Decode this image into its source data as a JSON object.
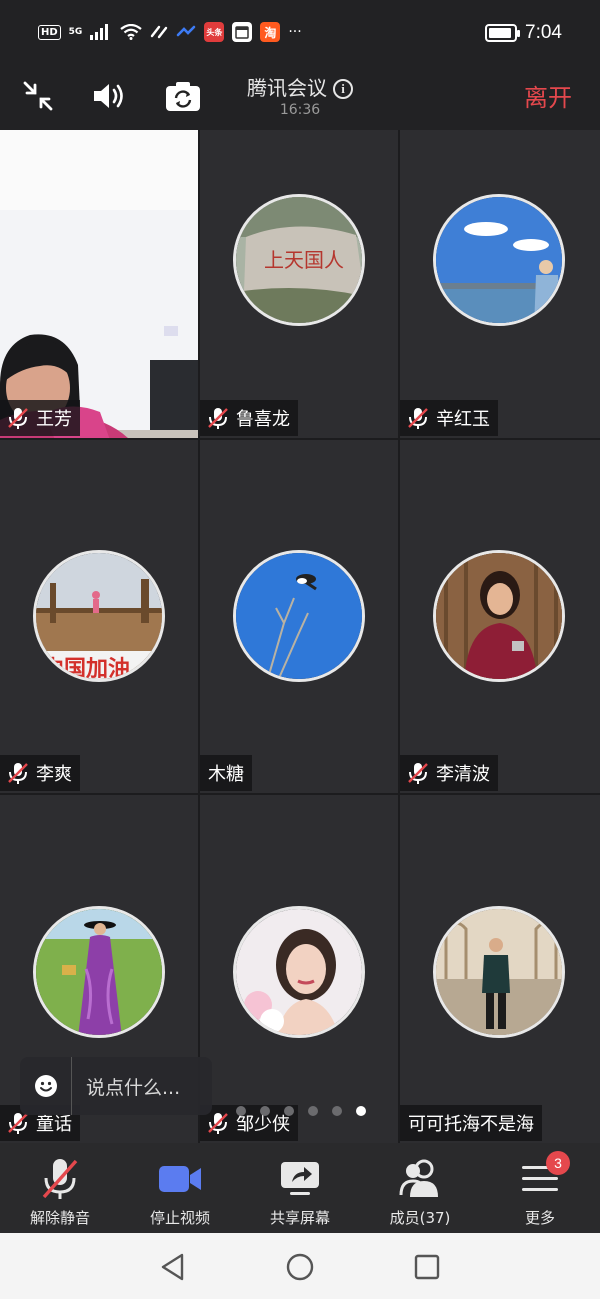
{
  "status_bar": {
    "hd": "HD",
    "network": "5G",
    "apps": [
      {
        "icon": "toutiao-app-icon",
        "label": "头条",
        "color": "#e03c3c"
      },
      {
        "icon": "calendar-app-icon",
        "label": "",
        "color": "#ffffff"
      },
      {
        "icon": "taobao-app-icon",
        "label": "淘",
        "color": "#ff5a1f"
      }
    ],
    "more": "···",
    "battery_level": 0.9,
    "time": "7:04"
  },
  "meeting": {
    "title": "腾讯会议",
    "timer": "16:36",
    "leave_label": "离开"
  },
  "participants": [
    {
      "name": "王芳",
      "muted": true,
      "type": "video"
    },
    {
      "name": "鲁喜龙",
      "muted": true,
      "type": "avatar",
      "avatar": "rock-avatar"
    },
    {
      "name": "辛红玉",
      "muted": true,
      "type": "avatar",
      "avatar": "lake-avatar"
    },
    {
      "name": "李爽",
      "muted": true,
      "type": "avatar",
      "avatar": "boardwalk-avatar",
      "avatar_text": "中国加油"
    },
    {
      "name": "木糖",
      "muted": false,
      "type": "avatar",
      "avatar": "bird-avatar"
    },
    {
      "name": "李清波",
      "muted": true,
      "type": "avatar",
      "avatar": "woman-red-avatar"
    },
    {
      "name": "童话",
      "muted": true,
      "type": "avatar",
      "avatar": "purple-dress-avatar"
    },
    {
      "name": "邹少侠",
      "muted": true,
      "type": "avatar",
      "avatar": "portrait-avatar"
    },
    {
      "name": "可可托海不是海",
      "muted": false,
      "type": "avatar",
      "avatar": "man-hall-avatar"
    }
  ],
  "chat": {
    "placeholder": "说点什么..."
  },
  "pagination": {
    "count": 6,
    "active": 5
  },
  "toolbar": {
    "unmute": "解除静音",
    "stop_video": "停止视频",
    "share_screen": "共享屏幕",
    "members": "成员(37)",
    "more": "更多",
    "more_badge": "3"
  },
  "colors": {
    "accent_red": "#e5484d",
    "video_blue": "#5b7cf0",
    "background": "#1f1f21"
  }
}
